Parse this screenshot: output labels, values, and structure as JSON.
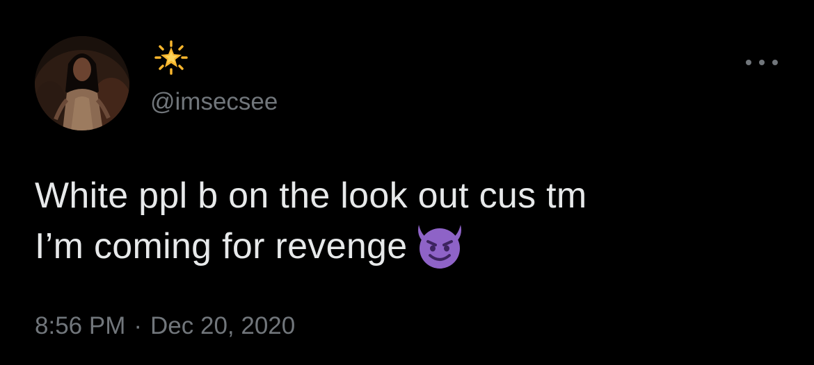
{
  "author": {
    "avatar_icon": "profile-photo",
    "display_name_icon": "glowing-star-emoji",
    "handle": "@imsecsee"
  },
  "menu": {
    "more_icon": "more-options-icon"
  },
  "tweet": {
    "text_line_1": "White ppl b on the look out cus tm",
    "text_line_2": "I’m coming for revenge",
    "emoji_icon": "smiling-face-with-horns-emoji"
  },
  "meta": {
    "time": "8:56 PM",
    "separator": "·",
    "date": "Dec 20, 2020"
  },
  "colors": {
    "background": "#000000",
    "primary_text": "#e7e9ea",
    "secondary_text": "#71767b",
    "emoji_purple": "#8e63c7",
    "star_yellow": "#f8b62d"
  }
}
